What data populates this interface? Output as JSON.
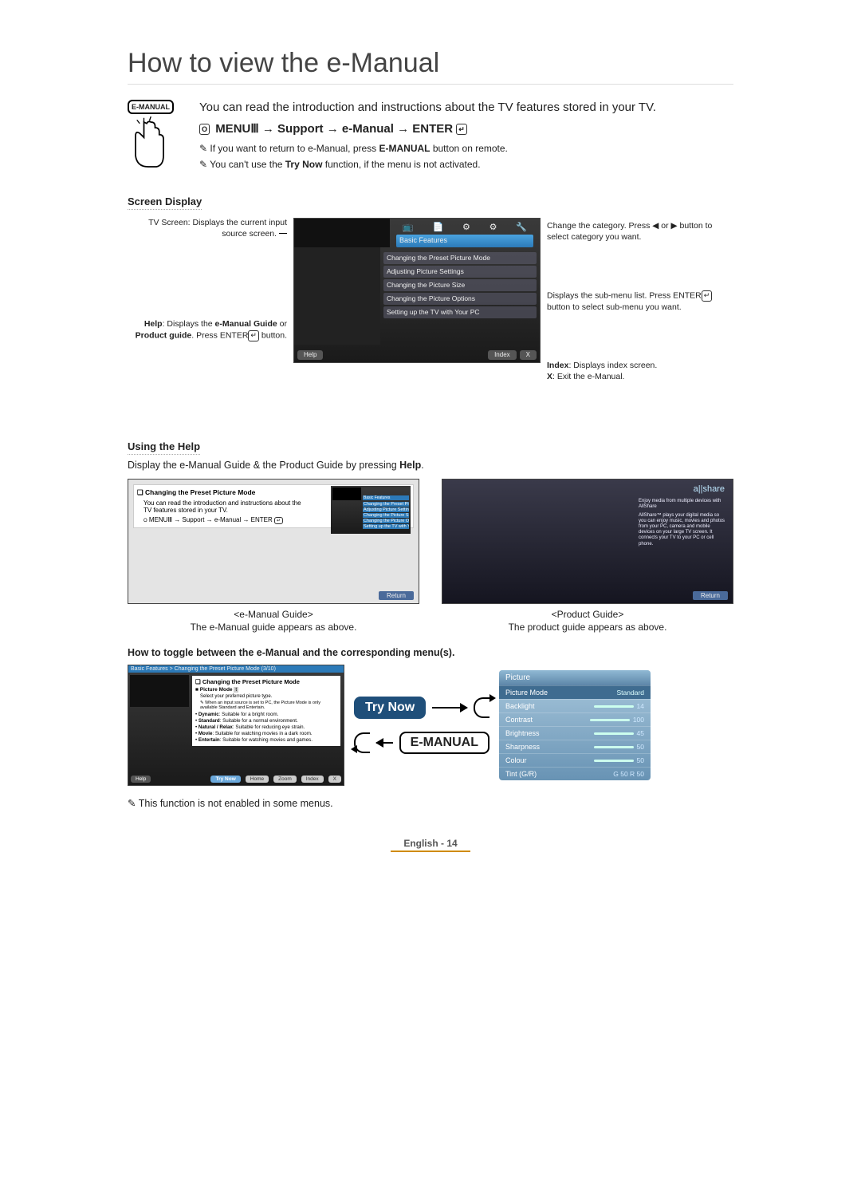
{
  "title": "How to view the e-Manual",
  "icon_label": "E-MANUAL",
  "intro_text": "You can read the introduction and instructions about the TV features stored in your TV.",
  "nav_path": {
    "prefix_icon": "O",
    "menu_label": "MENU",
    "menu_icon": "Ⅲ",
    "arrow": " → ",
    "support": "Support",
    "emanual": "e-Manual",
    "enter": "ENTER",
    "enter_icon": "↵"
  },
  "note1_a": "If you want to return to e-Manual, press ",
  "note1_b": "E-MANUAL",
  "note1_c": " button on remote.",
  "note2_a": "You can't use the ",
  "note2_b": "Try Now",
  "note2_c": " function, if the menu is not activated.",
  "section_screen": "Screen Display",
  "callouts": {
    "tv_screen": "TV Screen: Displays the current input source screen.",
    "help_a": "Help",
    "help_b": ": Displays the ",
    "help_c": "e-Manual Guide",
    "help_d": " or ",
    "help_e": "Product guide",
    "help_f": ". Press ENTER",
    "help_g": " button.",
    "change_a": "Change the category. Press ◀ or ▶ button to select category you want.",
    "submenu_a": "Displays the sub-menu list. Press ENTER",
    "submenu_b": " button to select sub-menu you want.",
    "index_a": "Index",
    "index_b": ": Displays index screen.",
    "x_a": "X",
    "x_b": ": Exit the e-Manual."
  },
  "device": {
    "category": "Basic Features",
    "items": [
      "Changing the Preset Picture Mode",
      "Adjusting Picture Settings",
      "Changing the Picture Size",
      "Changing the Picture Options",
      "Setting up the TV with Your PC"
    ],
    "help_btn": "Help",
    "index_btn": "Index",
    "x_btn": "X"
  },
  "section_help": "Using the Help",
  "help_desc_a": "Display the e-Manual Guide & the Product Guide by pressing ",
  "help_desc_b": "Help",
  "help_desc_c": ".",
  "guide_shot": {
    "title_icon": "❏",
    "title": "Changing the Preset Picture Mode",
    "desc": "You can read the introduction and instructions about the TV features stored in your TV.",
    "path_prefix": "O",
    "path": "MENUⅢ → Support → e-Manual → ENTER",
    "mini_cat": "Basic Features",
    "mini_items": [
      "Changing the Preset Picture Mode",
      "Adjusting Picture Settings",
      "Changing the Picture Size",
      "Changing the Picture Options",
      "Setting up the TV with Your PC"
    ],
    "return": "Return"
  },
  "product_shot": {
    "brand": "a||share",
    "headline": "Enjoy media from multiple devices with AllShare",
    "body": "AllShare™ plays your digital media so you can enjoy music, movies and photos from your PC, camera and mobile devices on your large TV screen. It connects your TV to your PC or cell phone.",
    "return": "Return"
  },
  "shot1_cap1": "<e-Manual Guide>",
  "shot1_cap2": "The e-Manual guide appears as above.",
  "shot2_cap1": "<Product Guide>",
  "shot2_cap2": "The product guide appears as above.",
  "toggle_heading": "How to toggle between the e-Manual and the corresponding menu(s).",
  "toggle_left": {
    "crumb": "Basic Features > Changing the Preset Picture Mode (3/10)",
    "panel_icon": "❏",
    "panel_title": "Changing the Preset Picture Mode",
    "pm_label": "Picture Mode",
    "pm_value": "t",
    "pm_desc": "Select your preferred picture type.",
    "pm_note": "When an input source is set to PC, the Picture Mode is only available Standard and Entertain.",
    "items": [
      {
        "name": "Dynamic",
        "desc": ": Suitable for a bright room."
      },
      {
        "name": "Standard",
        "desc": ": Suitable for a normal environment."
      },
      {
        "name": "Natural / Relax",
        "desc": ": Suitable for reducing eye strain."
      },
      {
        "name": "Movie",
        "desc": ": Suitable for watching movies in a dark room."
      },
      {
        "name": "Entertain",
        "desc": ": Suitable for watching movies and games."
      }
    ],
    "foot": [
      "Help",
      "Try Now",
      "Home",
      "Zoom",
      "Index",
      "X"
    ]
  },
  "try_now": "Try Now",
  "emanual_btn": "E-MANUAL",
  "osd": {
    "title": "Picture",
    "rows": [
      {
        "label": "Picture Mode",
        "value": "Standard",
        "selected": true
      },
      {
        "label": "Backlight",
        "value": "14"
      },
      {
        "label": "Contrast",
        "value": "100"
      },
      {
        "label": "Brightness",
        "value": "45"
      },
      {
        "label": "Sharpness",
        "value": "50"
      },
      {
        "label": "Colour",
        "value": "50"
      },
      {
        "label": "Tint (G/R)",
        "value": "G 50        R 50"
      }
    ]
  },
  "final_note": "This function is not enabled in some menus.",
  "footer": "English - 14"
}
